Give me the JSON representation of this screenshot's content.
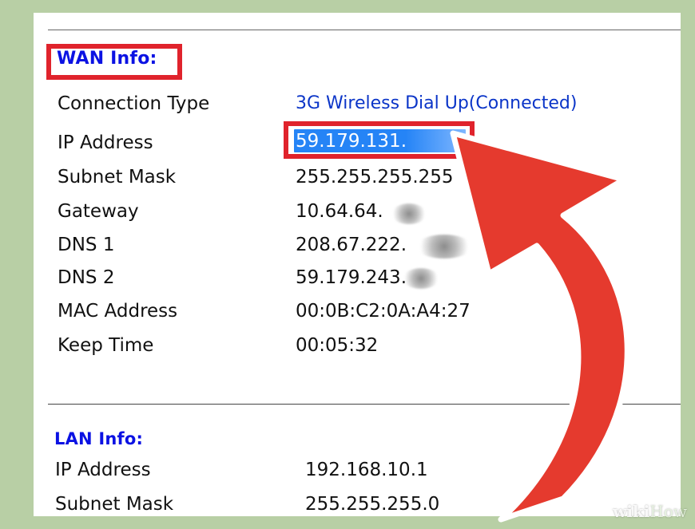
{
  "wan": {
    "title": "WAN Info:",
    "rows": [
      {
        "label": "Connection Type",
        "value": "3G Wireless Dial Up(Connected)"
      },
      {
        "label": "IP Address",
        "value": "59.179.131."
      },
      {
        "label": "Subnet Mask",
        "value": "255.255.255.255"
      },
      {
        "label": "Gateway",
        "value": "10.64.64."
      },
      {
        "label": "DNS 1",
        "value": "208.67.222."
      },
      {
        "label": "DNS 2",
        "value": "59.179.243."
      },
      {
        "label": "MAC Address",
        "value": "00:0B:C2:0A:A4:27"
      },
      {
        "label": "Keep Time",
        "value": "00:05:32"
      }
    ]
  },
  "lan": {
    "title": "LAN Info:",
    "rows": [
      {
        "label": "IP Address",
        "value": "192.168.10.1"
      },
      {
        "label": "Subnet Mask",
        "value": "255.255.255.0"
      }
    ]
  },
  "watermark": {
    "brand_part1": "wiki",
    "brand_part2": "How"
  },
  "colors": {
    "background": "#b8cfa5",
    "panel": "#ffffff",
    "title_blue": "#0b12e3",
    "link_blue": "#0b35c8",
    "highlight_red": "#e0232c",
    "selection_blue": "#2584f6"
  }
}
